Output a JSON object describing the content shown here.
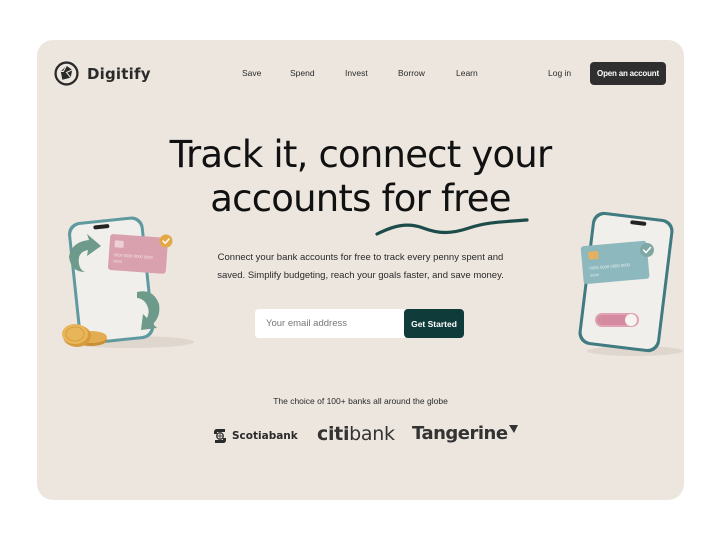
{
  "brand": {
    "name": "Digitify",
    "logo_icon": "aperture-logo-icon"
  },
  "nav": {
    "items": [
      {
        "label": "Save"
      },
      {
        "label": "Spend"
      },
      {
        "label": "Invest"
      },
      {
        "label": "Borrow"
      },
      {
        "label": "Learn"
      }
    ],
    "login_label": "Log in",
    "open_account_label": "Open an account"
  },
  "hero": {
    "headline_line1": "Track it, connect your",
    "headline_line2": "accounts for free",
    "subtext_line1": "Connect your bank accounts for free to track every penny spent and",
    "subtext_line2": "saved. Simplify budgeting, reach your goals faster, and save money.",
    "email_placeholder": "Your email address",
    "email_value": "",
    "cta_label": "Get Started"
  },
  "banks": {
    "caption": "The choice of 100+ banks all around the globe",
    "logos": [
      {
        "name": "Scotiabank"
      },
      {
        "name": "citibank",
        "part1": "citi",
        "part2": "bank"
      },
      {
        "name": "Tangerine"
      }
    ]
  },
  "illustrations": {
    "left": {
      "card_number": "0000 0000 0000 0000",
      "card_sub": "00/00"
    },
    "right": {
      "card_number": "0000 0000 0000 0000",
      "card_sub": "00/00"
    }
  },
  "colors": {
    "page_bg": "#ffffff",
    "card_bg": "#ede6df",
    "cta_bg": "#0f3b3a",
    "open_btn_bg": "#2f2f2f",
    "pink_card": "#d9a1ad",
    "teal_card": "#8cb8be",
    "phone_teal": "#4f8a8e",
    "coin_gold": "#e0a94a"
  }
}
